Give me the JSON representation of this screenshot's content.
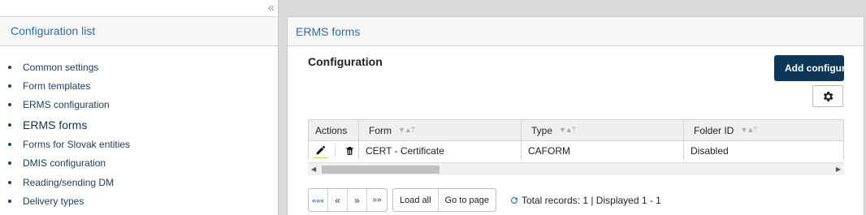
{
  "sidebar": {
    "collapse_glyph": "«",
    "title": "Configuration list",
    "items": [
      {
        "label": "Common settings"
      },
      {
        "label": "Form templates"
      },
      {
        "label": "ERMS configuration"
      },
      {
        "label": "ERMS forms"
      },
      {
        "label": "Forms for Slovak entities"
      },
      {
        "label": "DMIS configuration"
      },
      {
        "label": "Reading/sending DM"
      },
      {
        "label": "Delivery types"
      }
    ],
    "active_index": 3
  },
  "panel": {
    "title": "ERMS forms",
    "section_title": "Configuration",
    "add_button": "Add configura",
    "settings_icon": "gear-icon"
  },
  "table": {
    "headers": [
      "Actions",
      "Form",
      "Type",
      "Folder ID"
    ],
    "rows": [
      {
        "form": "CERT - Certificate",
        "type": "CAFORM",
        "folder_id": "Disabled"
      }
    ]
  },
  "pager": {
    "first": "«««",
    "prev": "«",
    "next": "»",
    "last": "»»",
    "load_all": "Load all",
    "go_to_page": "Go to page",
    "status": "Total records: 1 | Displayed 1 - 1"
  },
  "colors": {
    "accent": "#2f6ea6",
    "primary_button": "#0d3657"
  }
}
